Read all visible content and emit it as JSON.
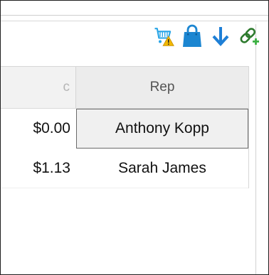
{
  "toolbar": {
    "icons": [
      "shopping-cart-warning-icon",
      "shopping-bag-icon",
      "download-arrow-icon",
      "link-add-icon"
    ],
    "colors": {
      "cart": "#27a4e6",
      "warning": "#f2b800",
      "bag": "#1c86d1",
      "arrow": "#1e7fd6",
      "link": "#2d7a2d",
      "plus": "#3cb043"
    }
  },
  "grid": {
    "headers": {
      "amount_partial": "c",
      "rep": "Rep"
    },
    "rows": [
      {
        "amount": "$0.00",
        "rep": "Anthony Kopp",
        "selected": true
      },
      {
        "amount": "$1.13",
        "rep": "Sarah James",
        "selected": false
      }
    ]
  }
}
